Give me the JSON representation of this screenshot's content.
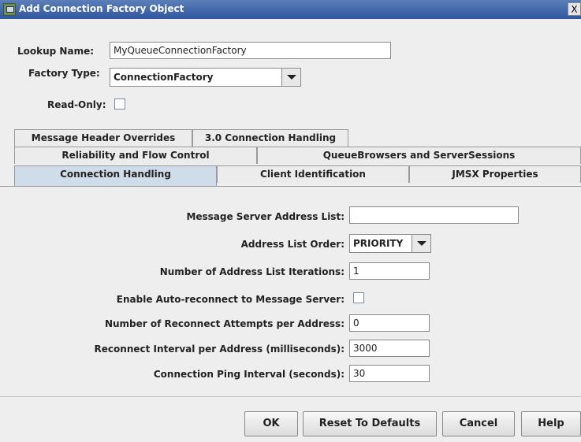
{
  "window": {
    "title": "Add Connection Factory Object",
    "close_label": "X"
  },
  "form": {
    "lookup_label": "Lookup Name:",
    "lookup_value": "MyQueueConnectionFactory",
    "factory_label": "Factory Type:",
    "factory_value": "ConnectionFactory",
    "readonly_label": "Read-Only:",
    "readonly_checked": false
  },
  "tabs": {
    "row1": [
      "Message Header Overrides",
      "3.0 Connection Handling"
    ],
    "row2": [
      "Reliability and Flow Control",
      "QueueBrowsers and ServerSessions"
    ],
    "row3": [
      "Connection Handling",
      "Client Identification",
      "JMSX Properties"
    ],
    "selected": "Connection Handling"
  },
  "connection": {
    "address_list_label": "Message Server Address List:",
    "address_list_value": "",
    "order_label": "Address List Order:",
    "order_value": "PRIORITY",
    "iterations_label": "Number of Address List Iterations:",
    "iterations_value": "1",
    "autoreconnect_label": "Enable Auto-reconnect to Message Server:",
    "autoreconnect_checked": false,
    "attempts_label": "Number of Reconnect Attempts per Address:",
    "attempts_value": "0",
    "interval_label": "Reconnect Interval per Address (milliseconds):",
    "interval_value": "3000",
    "ping_label": "Connection Ping Interval (seconds):",
    "ping_value": "30"
  },
  "buttons": {
    "ok": "OK",
    "reset": "Reset To Defaults",
    "cancel": "Cancel",
    "help": "Help"
  }
}
